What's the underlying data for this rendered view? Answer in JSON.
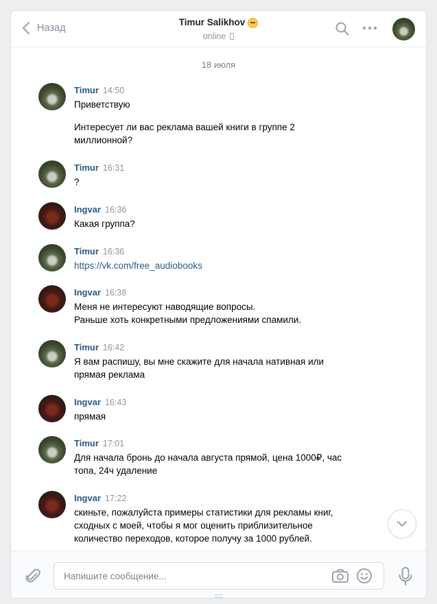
{
  "header": {
    "back_label": "Назад",
    "peer_name": "Timur Salikhov",
    "peer_emoji": "relieved-face-emoji",
    "status": "online",
    "status_icon": "mobile-phone-icon"
  },
  "date_separator": "18 июля",
  "messages": [
    {
      "author": "Timur",
      "avatar": "timur",
      "time": "14:50",
      "paragraphs": [
        "Приветствую",
        "Интересует ли вас реклама вашей книги в группе 2\nмиллионной?"
      ]
    },
    {
      "author": "Timur",
      "avatar": "timur",
      "time": "16:31",
      "paragraphs": [
        "?"
      ]
    },
    {
      "author": "Ingvar",
      "avatar": "ingvar",
      "time": "16:36",
      "paragraphs": [
        "Какая группа?"
      ]
    },
    {
      "author": "Timur",
      "avatar": "timur",
      "time": "16:36",
      "link": "https://vk.com/free_audiobooks"
    },
    {
      "author": "Ingvar",
      "avatar": "ingvar",
      "time": "16:38",
      "paragraphs": [
        "Меня не интересуют наводящие вопросы.\nРаньше хоть конкретными предложениями спамили."
      ]
    },
    {
      "author": "Timur",
      "avatar": "timur",
      "time": "16:42",
      "paragraphs": [
        "Я вам распишу, вы мне скажите для начала нативная или\nпрямая реклама"
      ]
    },
    {
      "author": "Ingvar",
      "avatar": "ingvar",
      "time": "16:43",
      "paragraphs": [
        "прямая"
      ]
    },
    {
      "author": "Timur",
      "avatar": "timur",
      "time": "17:01",
      "paragraphs": [
        "Для начала бронь до начала августа прямой, цена 1000₽, час\nтопа, 24ч удаление"
      ]
    },
    {
      "author": "Ingvar",
      "avatar": "ingvar",
      "time": "17:22",
      "paragraphs": [
        "скиньте, пожалуйста примеры статистики для рекламы книг,\nсходных с моей, чтобы я мог оценить приблизительное\nколичество переходов, которое получу за 1000 рублей."
      ]
    }
  ],
  "composer": {
    "placeholder": "Напишите сообщение..."
  },
  "colors": {
    "accent": "#2a5885",
    "muted": "#939393",
    "border": "#dce1e6",
    "background": "#edeef0"
  }
}
